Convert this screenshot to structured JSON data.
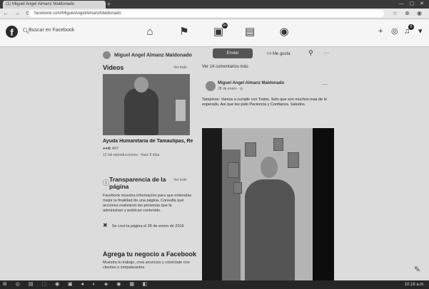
{
  "browser": {
    "tab_title": "(1) Miguel Angel Almanz Maldonado",
    "url": "facebook.com/MiguelAngelAlmanzMaldonado",
    "nav_icons": [
      "back-icon",
      "forward-icon",
      "reload-icon"
    ]
  },
  "fb_header": {
    "search_placeholder": "Buscar en Facebook",
    "nav_icons": [
      {
        "name": "home-icon",
        "glyph": "⌂",
        "badge": ""
      },
      {
        "name": "flag-icon",
        "glyph": "⚑",
        "badge": ""
      },
      {
        "name": "watch-icon",
        "glyph": "▣",
        "badge": "9+"
      },
      {
        "name": "marketplace-icon",
        "glyph": "▤",
        "badge": ""
      },
      {
        "name": "groups-icon",
        "glyph": "◉",
        "badge": ""
      }
    ],
    "right_icons": [
      {
        "name": "plus-icon",
        "glyph": "+"
      },
      {
        "name": "messenger-icon",
        "glyph": "◎"
      },
      {
        "name": "bell-icon",
        "glyph": "♫",
        "badge": "9"
      },
      {
        "name": "account-menu-icon",
        "glyph": "▾"
      }
    ]
  },
  "profile": {
    "name": "Miguel Angel Almanz Maldonado",
    "primary_button": "Enviar",
    "like_label": "Me gusta"
  },
  "videos_section": {
    "title": "Videos",
    "see_all": "Ver todo",
    "video_title": "Ayuda Humanitaria de Tamaulipas, Reci…",
    "reactions": "407",
    "meta": "12 mil reproducciones · hace 6 días"
  },
  "transparency": {
    "title": "Transparencia de la página",
    "see_all": "Ver todo",
    "body": "Facebook muestra información para que entiendas mejor la finalidad de una página. Consulta qué acciones realizaron las personas que la administran y publican contenido.",
    "created": "Se creó la página el 26 de enero de 2016"
  },
  "business": {
    "title": "Agrega tu negocio a Facebook",
    "body": "Muestra tu trabajo, crea anuncios y conéctate con clientes o simpatizantes."
  },
  "post": {
    "comments_link": "Ver 14 comentarios más",
    "author": "Miguel Angel Almanz Maldonado",
    "date": "28 de enero · ◎",
    "text": "Tampinos: Vamos a cumplir con Todos. Solo que son muchos mas de lo esperado. Así que les pido Paciencia y Confianza. Saludos."
  },
  "taskbar": {
    "clock": "10:16 a.m."
  }
}
